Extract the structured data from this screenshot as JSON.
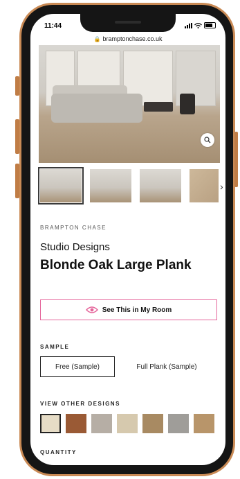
{
  "status": {
    "time": "11:44"
  },
  "url": "bramptonchase.co.uk",
  "gallery": {
    "zoom_icon": "search-icon",
    "thumbnails": [
      "room-view-1",
      "room-view-2",
      "room-view-3",
      "plank-swatch"
    ],
    "next_icon": "chevron-right-icon"
  },
  "product": {
    "brand": "BRAMPTON CHASE",
    "range": "Studio Designs",
    "title": "Blonde Oak Large Plank",
    "room_button": "See This in My Room"
  },
  "sample": {
    "label": "SAMPLE",
    "options": [
      "Free (Sample)",
      "Full Plank (Sample)"
    ],
    "selected": "Free (Sample)"
  },
  "designs": {
    "label": "VIEW OTHER DESIGNS",
    "colors": [
      "#e6dcc6",
      "#9a5a35",
      "#b6aea5",
      "#d6c9ae",
      "#a88a62",
      "#9f9d99",
      "#b8956a"
    ]
  },
  "quantity": {
    "label": "QUANTITY"
  },
  "theme": {
    "accent": "#e5649a",
    "frame": "#c98a55"
  }
}
